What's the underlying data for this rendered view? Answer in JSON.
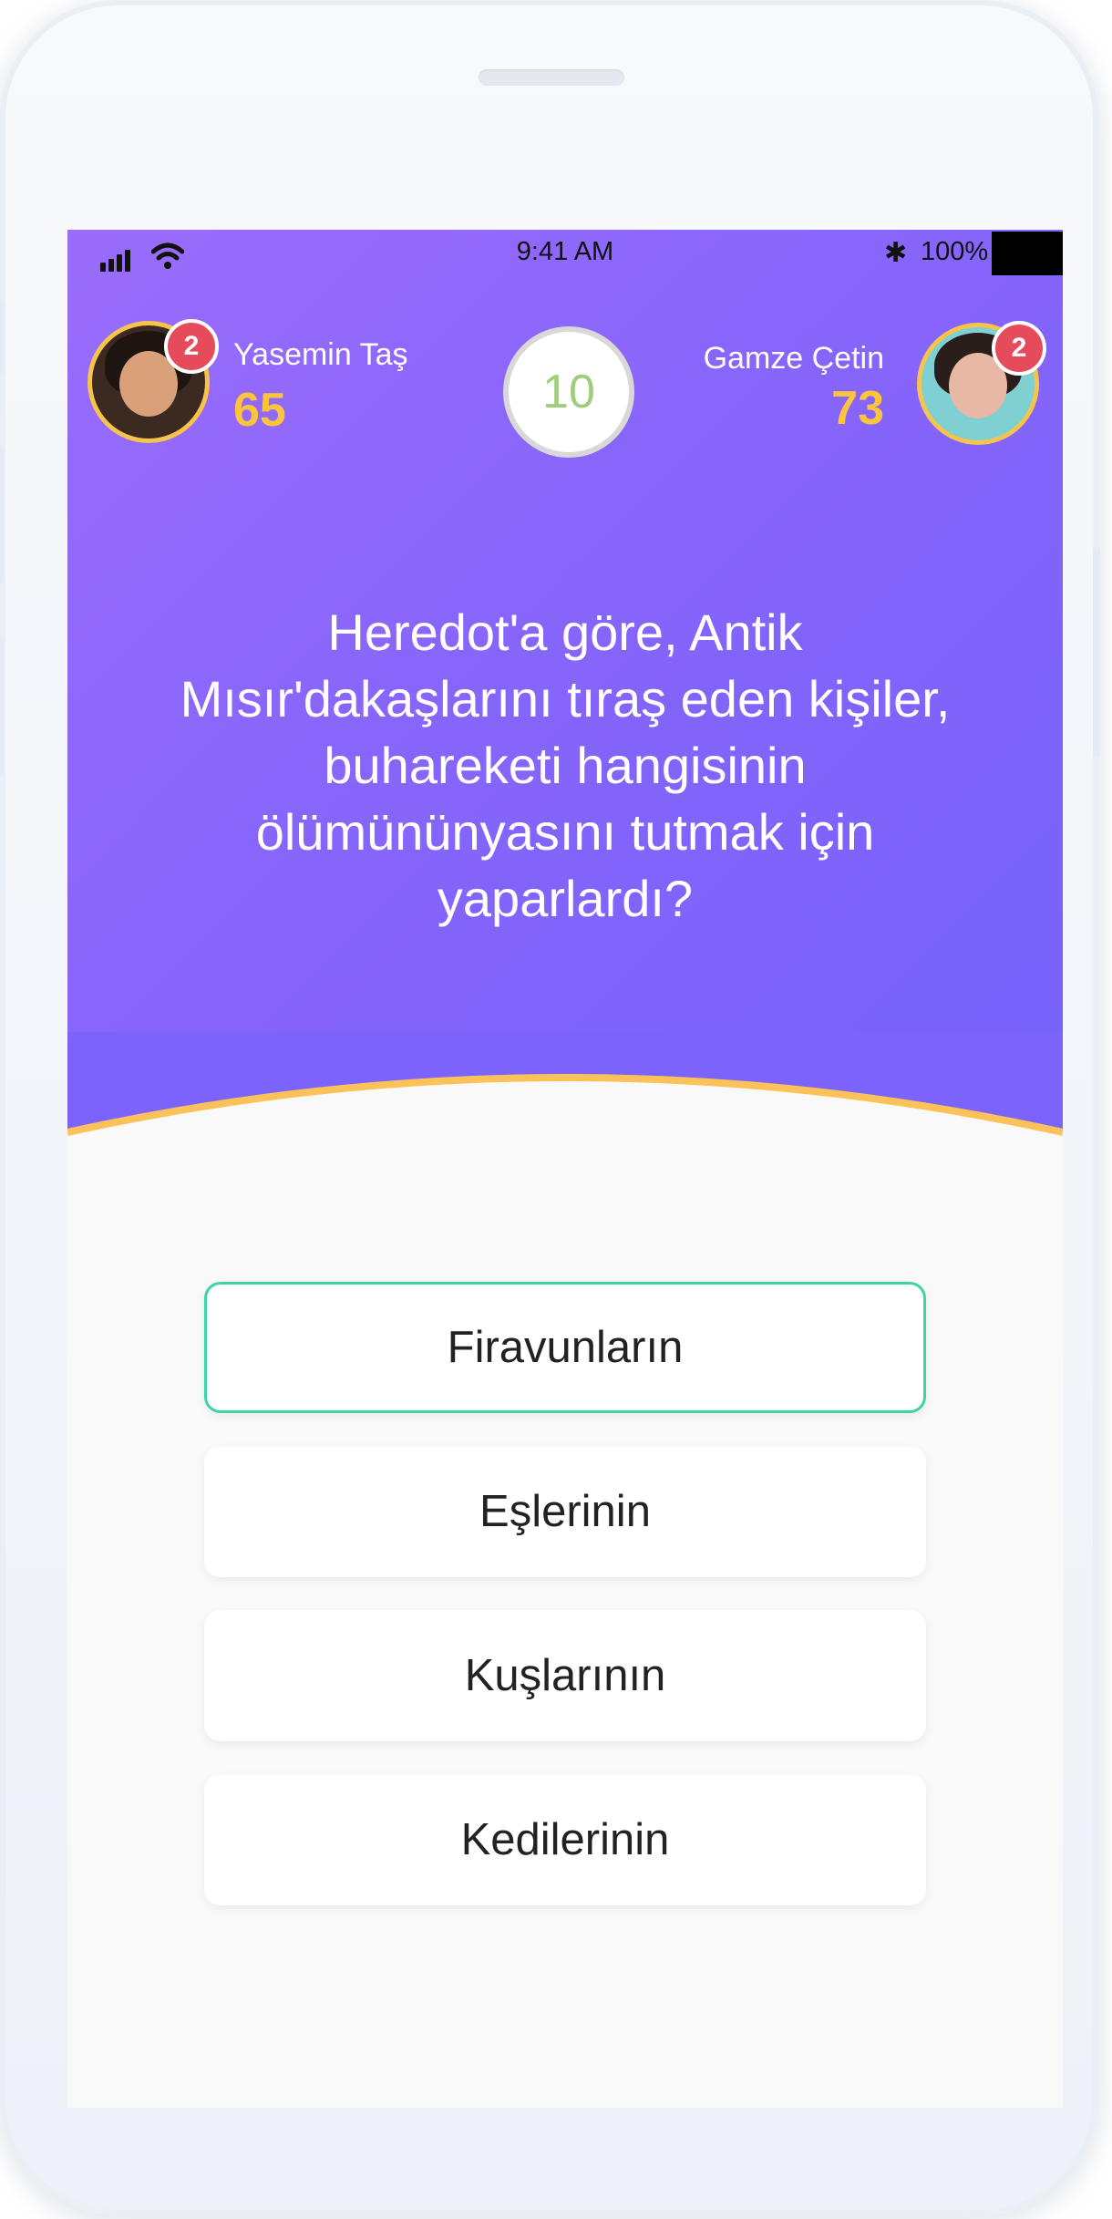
{
  "status_bar": {
    "time": "9:41 AM",
    "battery": "100%"
  },
  "players": {
    "left": {
      "name": "Yasemin Taş",
      "score": "65",
      "badge": "2"
    },
    "right": {
      "name": "Gamze Çetin",
      "score": "73",
      "badge": "2"
    }
  },
  "timer": "10",
  "question": "Heredot'a göre, Antik Mısır'dakaşlarını tıraş eden kişiler, buhareketi hangisinin ölümününyasını tutmak için yaparlardı?",
  "answers": [
    {
      "label": "Firavunların",
      "selected": true
    },
    {
      "label": "Eşlerinin",
      "selected": false
    },
    {
      "label": "Kuşlarının",
      "selected": false
    },
    {
      "label": "Kedilerinin",
      "selected": false
    }
  ],
  "colors": {
    "accent_purple": "#8765fb",
    "score_yellow": "#fcc43a",
    "badge_red": "#e54b5a",
    "selected_border": "#3fd2a6",
    "timer_text": "#9fcd7f"
  }
}
